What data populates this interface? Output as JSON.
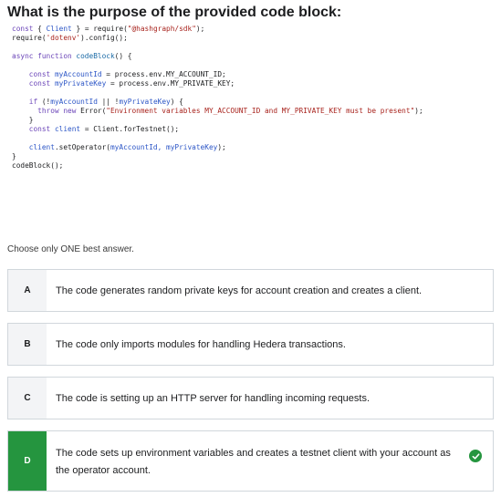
{
  "question": {
    "title": "What is the purpose of the provided code block:"
  },
  "code": {
    "l1_kw": "const",
    "l1_a": " { ",
    "l1_id": "Client",
    "l1_b": " } = require(",
    "l1_str": "\"@hashgraph/sdk\"",
    "l1_c": ");",
    "l2_a": "require(",
    "l2_str": "'dotenv'",
    "l2_b": ").config();",
    "l4_kw": "async function",
    "l4_fn": " codeBlock",
    "l4_b": "() {",
    "l6_kw": "const",
    "l6_id": " myAccountId",
    "l6_b": " = process.env.MY_ACCOUNT_ID;",
    "l7_kw": "const",
    "l7_id": " myPrivateKey",
    "l7_b": " = process.env.MY_PRIVATE_KEY;",
    "l9_kw": "if",
    "l9_a": " (!",
    "l9_id1": "myAccountId",
    "l9_b": " || !",
    "l9_id2": "myPrivateKey",
    "l9_c": ") {",
    "l10_kw": "throw new",
    "l10_b": " Error(",
    "l10_str": "\"Environment variables MY_ACCOUNT_ID and MY_PRIVATE_KEY must be present\"",
    "l10_c": ");",
    "l11": "}",
    "l12_kw": "const",
    "l12_id": " client",
    "l12_b": " = Client.forTestnet();",
    "l14_id": "client",
    "l14_b": ".setOperator(",
    "l14_args": "myAccountId, myPrivateKey",
    "l14_c": ");",
    "l15": "}",
    "l16": "codeBlock();"
  },
  "instructions": "Choose only ONE best answer.",
  "options": [
    {
      "letter": "A",
      "text": "The code generates random private keys for account creation and creates a client."
    },
    {
      "letter": "B",
      "text": "The code only imports modules for handling Hedera transactions."
    },
    {
      "letter": "C",
      "text": "The code is setting up an HTTP server for handling incoming requests."
    },
    {
      "letter": "D",
      "text": "The code sets up environment variables and creates a testnet client with your account as the operator account.",
      "correct": true
    }
  ],
  "colors": {
    "correct": "#25953f",
    "border": "#d1d7dc",
    "letter_bg": "#f3f4f6"
  }
}
